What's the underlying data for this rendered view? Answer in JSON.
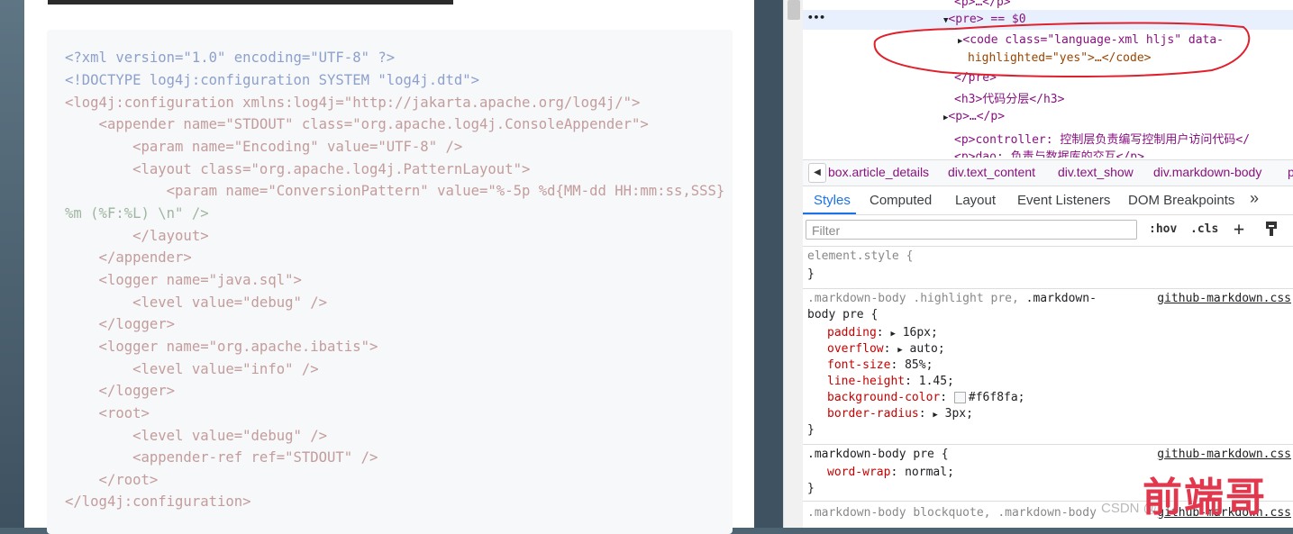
{
  "article": {
    "code_lines": [
      "<?xml version=\"1.0\" encoding=\"UTF-8\" ?>",
      "<!DOCTYPE log4j:configuration SYSTEM \"log4j.dtd\">",
      "<log4j:configuration xmlns:log4j=\"http://jakarta.apache.org/log4j/\">",
      "    <appender name=\"STDOUT\" class=\"org.apache.log4j.ConsoleAppender\">",
      "        <param name=\"Encoding\" value=\"UTF-8\" />",
      "        <layout class=\"org.apache.log4j.PatternLayout\">",
      "            <param name=\"ConversionPattern\" value=\"%-5p %d{MM-dd HH:mm:ss,SSS}",
      "%m (%F:%L) \\n\" />",
      "        </layout>",
      "    </appender>",
      "    <logger name=\"java.sql\">",
      "        <level value=\"debug\" />",
      "    </logger>",
      "    <logger name=\"org.apache.ibatis\">",
      "        <level value=\"info\" />",
      "    </logger>",
      "    <root>",
      "        <level value=\"debug\" />",
      "        <appender-ref ref=\"STDOUT\" />",
      "    </root>",
      "</log4j:configuration>"
    ]
  },
  "dom": {
    "lines": [
      "<p>…</p>",
      "<pre> == $0",
      "<code class=\"language-xml hljs\" data-",
      "highlighted=\"yes\">…</code>",
      "</pre>",
      "<h3>代码分层</h3>",
      "<p>…</p>",
      "<p>controller: 控制层负责编写控制用户访问代码</",
      "<p>dao: 负责与数据库的交互</p>"
    ],
    "dots": "•••"
  },
  "breadcrumbs": [
    "box.article_details",
    "div.text_content",
    "div.text_show",
    "div.markdown-body",
    "p"
  ],
  "tabs": [
    "Styles",
    "Computed",
    "Layout",
    "Event Listeners",
    "DOM Breakpoints",
    "»"
  ],
  "filter": {
    "placeholder": "Filter",
    "hov": ":hov",
    "cls": ".cls",
    "plus": "+"
  },
  "styles": {
    "element_style": "element.style {",
    "close": "}",
    "rule1": {
      "selector_a": ".markdown-body .highlight pre, ",
      "selector_b": ".markdown-",
      "selector_c": "body pre {",
      "source": "github-markdown.css",
      "props": [
        {
          "name": "padding",
          "value": "16px;"
        },
        {
          "name": "overflow",
          "value": "auto;"
        },
        {
          "name": "font-size",
          "value": "85%;"
        },
        {
          "name": "line-height",
          "value": "1.45;"
        },
        {
          "name": "background-color",
          "value": "#f6f8fa;"
        },
        {
          "name": "border-radius",
          "value": "3px;"
        }
      ]
    },
    "rule2": {
      "selector": ".markdown-body pre {",
      "source": "github-markdown.css",
      "props": [
        {
          "name": "word-wrap",
          "value": "normal;"
        }
      ]
    },
    "rule3": {
      "selector": ".markdown-body blockquote, .markdown-body",
      "source": "github-markdown.css"
    }
  },
  "watermark": {
    "csdn": "CSDN @",
    "brand": "前端哥"
  },
  "colors": {
    "accent": "#1a73e8",
    "annotation": "#e0202c"
  }
}
